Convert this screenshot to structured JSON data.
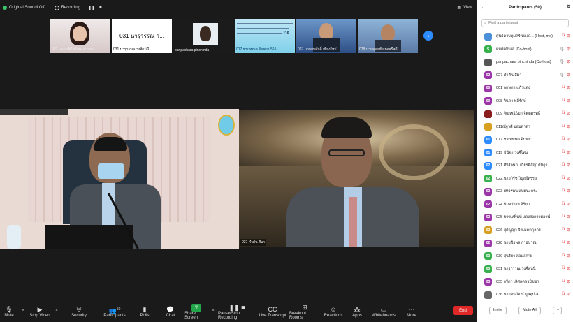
{
  "topbar": {
    "audio_label": "Original Soundi Off",
    "recording_label": "Recording...",
    "pause_icon": "pause-icon",
    "stop_icon": "stop-icon",
    "view_label": "View"
  },
  "gallery": [
    {
      "label": "052 นางเกศินีทร์เกษ  สว่างณ",
      "style": "t1"
    },
    {
      "label": "031 นารุวรรณ  วงศ์แน่นี",
      "style": "t2",
      "big_text": "031 นารุวรรณ  ว..."
    },
    {
      "label": "panpachara pinchinda",
      "style": "t3"
    },
    {
      "label": "017 ชรเทพนต อินพยา 565",
      "style": "t4"
    },
    {
      "label": "067 นายสมศักดิ์ เชียงใหม่",
      "style": "t5"
    },
    {
      "label": "078 นายสุดนชัย  ยุดศรีสดี",
      "style": "t6"
    }
  ],
  "main_videos": {
    "left_label": "",
    "right_label": "027 คำตัน สีมา"
  },
  "toolbar": {
    "mute": "Mute",
    "stop_video": "Stop Video",
    "security": "Security",
    "participants": "Participants",
    "participants_count": "50",
    "polls": "Polls",
    "chat": "Chat",
    "share_screen": "Share Screen",
    "recording": "Pause/Stop Recording",
    "live_transcript": "Live Transcript",
    "breakout_rooms": "Breakout Rooms",
    "reactions": "Reactions",
    "apps": "Apps",
    "whiteboards": "Whiteboards",
    "more": "More",
    "end": "End"
  },
  "panel": {
    "title": "Participants (50)",
    "search_placeholder": "Find a participant",
    "invite": "Invite",
    "mute_all": "Mute All",
    "more": "···",
    "participants": [
      {
        "name": "ศูนย์ควบคุมคร์ ท้องถ... (Host, me)",
        "avatar": "",
        "color": "#4a90d9",
        "mic": "muted-outline",
        "cam": "off"
      },
      {
        "name": "ผมศดจินเส (Co-host)",
        "avatar": "S",
        "color": "#38b04d",
        "mic": "on",
        "cam": "off"
      },
      {
        "name": "panpachara pinchinda (Co-host)",
        "avatar": "",
        "color": "#555",
        "mic": "on",
        "cam": "off"
      },
      {
        "name": "027 คำตัน สีมา",
        "avatar": "02",
        "color": "#9b36a8",
        "mic": "on",
        "cam": "off"
      },
      {
        "name": "001 กฤษดา  แก้วแสง",
        "avatar": "00",
        "color": "#9b36a8",
        "mic": "off",
        "cam": "off"
      },
      {
        "name": "008 จินดา  พลีรักษ์",
        "avatar": "00",
        "color": "#9b36a8",
        "mic": "off",
        "cam": "off"
      },
      {
        "name": "009 จิณหณีธิมา  จิตตศรทธิ์",
        "avatar": "",
        "color": "#8a1e1e",
        "mic": "off",
        "cam": "off"
      },
      {
        "name": "011ณัฐวดี ม่อมสาดา",
        "avatar": "",
        "color": "#d8a020",
        "mic": "off",
        "cam": "off"
      },
      {
        "name": "017 ชรเทพนต อินพยา",
        "avatar": "01",
        "color": "#2d8cff",
        "mic": "off",
        "cam": "off"
      },
      {
        "name": "019 ปนัดา วงศ์ไหม",
        "avatar": "01",
        "color": "#2d8cff",
        "mic": "off",
        "cam": "off"
      },
      {
        "name": "021 ศิริลักษณ์ เกียรติสัญไต้พิกุร",
        "avatar": "02",
        "color": "#2d8cff",
        "mic": "off",
        "cam": "off"
      },
      {
        "name": "022.นายวิรัช  วิบูลย์ทรรย",
        "avatar": "02",
        "color": "#38b04d",
        "mic": "off",
        "cam": "off"
      },
      {
        "name": "023 ยทรรพน  แปมนะ์กระ",
        "avatar": "02",
        "color": "#9b36a8",
        "mic": "off",
        "cam": "off"
      },
      {
        "name": "024 นิ่มอรัยรส  สิริยา",
        "avatar": "02",
        "color": "#9b36a8",
        "mic": "off",
        "cam": "off"
      },
      {
        "name": "025 บรรเทพินท์ แดงสงกรามอาน์",
        "avatar": "02",
        "color": "#9b36a8",
        "mic": "off",
        "cam": "off"
      },
      {
        "name": "026 สุกัญญา จิตเมตตกุลกร",
        "avatar": "02",
        "color": "#d8a020",
        "mic": "off",
        "cam": "off"
      },
      {
        "name": "028 นายปิยพล  กาธปาณ",
        "avatar": "02",
        "color": "#9b36a8",
        "mic": "off",
        "cam": "off"
      },
      {
        "name": "030 สุนรียา  สอนสกาย",
        "avatar": "03",
        "color": "#38b04d",
        "mic": "off",
        "cam": "off"
      },
      {
        "name": "031 นารุวรรณ  วงศ์แน่นี",
        "avatar": "03",
        "color": "#38b04d",
        "mic": "off",
        "cam": "off"
      },
      {
        "name": "035 กรีดา  เลิศลดลวมิชชา",
        "avatar": "03",
        "color": "#9b36a8",
        "mic": "off",
        "cam": "off"
      },
      {
        "name": "036 นายอนวัฒน์ นูลอุปเล",
        "avatar": "",
        "color": "#666",
        "mic": "off",
        "cam": "off"
      }
    ]
  },
  "colors": {
    "accent": "#2d8cff",
    "share_green": "#22a64a",
    "end_red": "#e02828"
  }
}
